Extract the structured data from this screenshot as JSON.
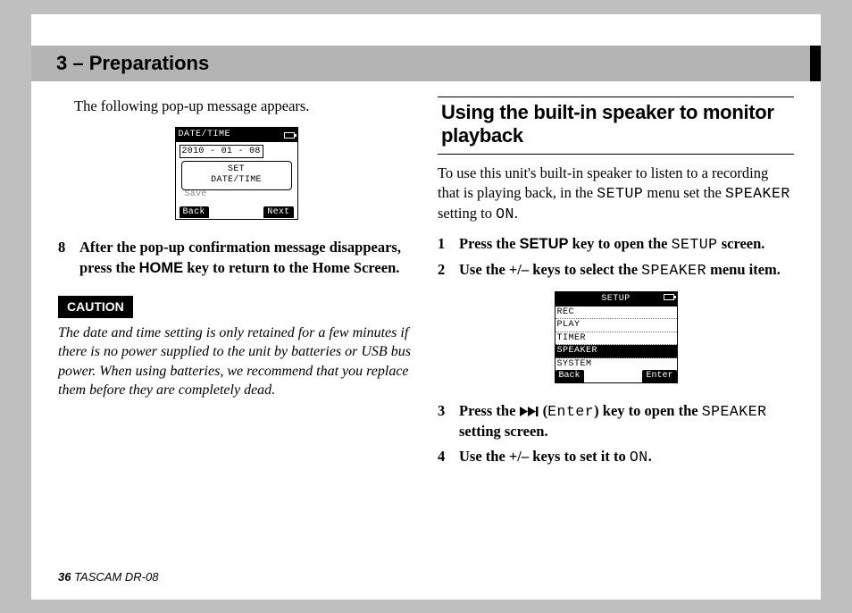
{
  "chapter_title": "3 – Preparations",
  "left": {
    "intro": "The following pop-up message appears.",
    "lcd1": {
      "title": "DATE/TIME",
      "date": "2010 - 01 - 08",
      "popup_l1": "SET",
      "popup_l2": "DATE/TIME",
      "faded": "Save",
      "back": "Back",
      "next": "Next"
    },
    "step8_num": "8",
    "step8_a": "After the pop-up confirmation message disappears, press the ",
    "step8_key": "HOME",
    "step8_b": " key to return to the Home Screen.",
    "caution_label": "CAUTION",
    "caution_text": "The date and time setting is only retained for a few minutes if there is no power supplied to the unit by batteries or USB bus power. When using batteries, we recommend that you replace them before they are completely dead."
  },
  "right": {
    "heading": "Using the built-in speaker to monitor playback",
    "intro_a": "To use this unit's built-in speaker to listen to a recording that is playing back, in the ",
    "intro_setup": "SETUP",
    "intro_b": " menu set the ",
    "intro_speaker": "SPEAKER",
    "intro_c": " setting to ",
    "intro_on": "ON",
    "intro_d": ".",
    "step1_num": "1",
    "step1_a": "Press the ",
    "step1_key": "SETUP",
    "step1_b": " key to open the ",
    "step1_screen": "SETUP",
    "step1_c": " screen.",
    "step2_num": "2",
    "step2_a": "Use the +/– keys to select the ",
    "step2_speaker": "SPEAKER",
    "step2_b": " menu item.",
    "lcd2": {
      "title": "SETUP",
      "items": [
        "REC",
        "PLAY",
        "TIMER",
        "SPEAKER",
        "SYSTEM"
      ],
      "selected_index": 3,
      "back": "Back",
      "enter": "Enter"
    },
    "step3_num": "3",
    "step3_a": "Press the ",
    "step3_enter": "Enter",
    "step3_b": ") key to open the ",
    "step3_speaker": "SPEAKER",
    "step3_c": " setting screen.",
    "step4_num": "4",
    "step4_a": "Use the +/– keys to set it to ",
    "step4_on": "ON",
    "step4_b": "."
  },
  "footer": {
    "page_num": "36",
    "model": " TASCAM  DR-08"
  }
}
